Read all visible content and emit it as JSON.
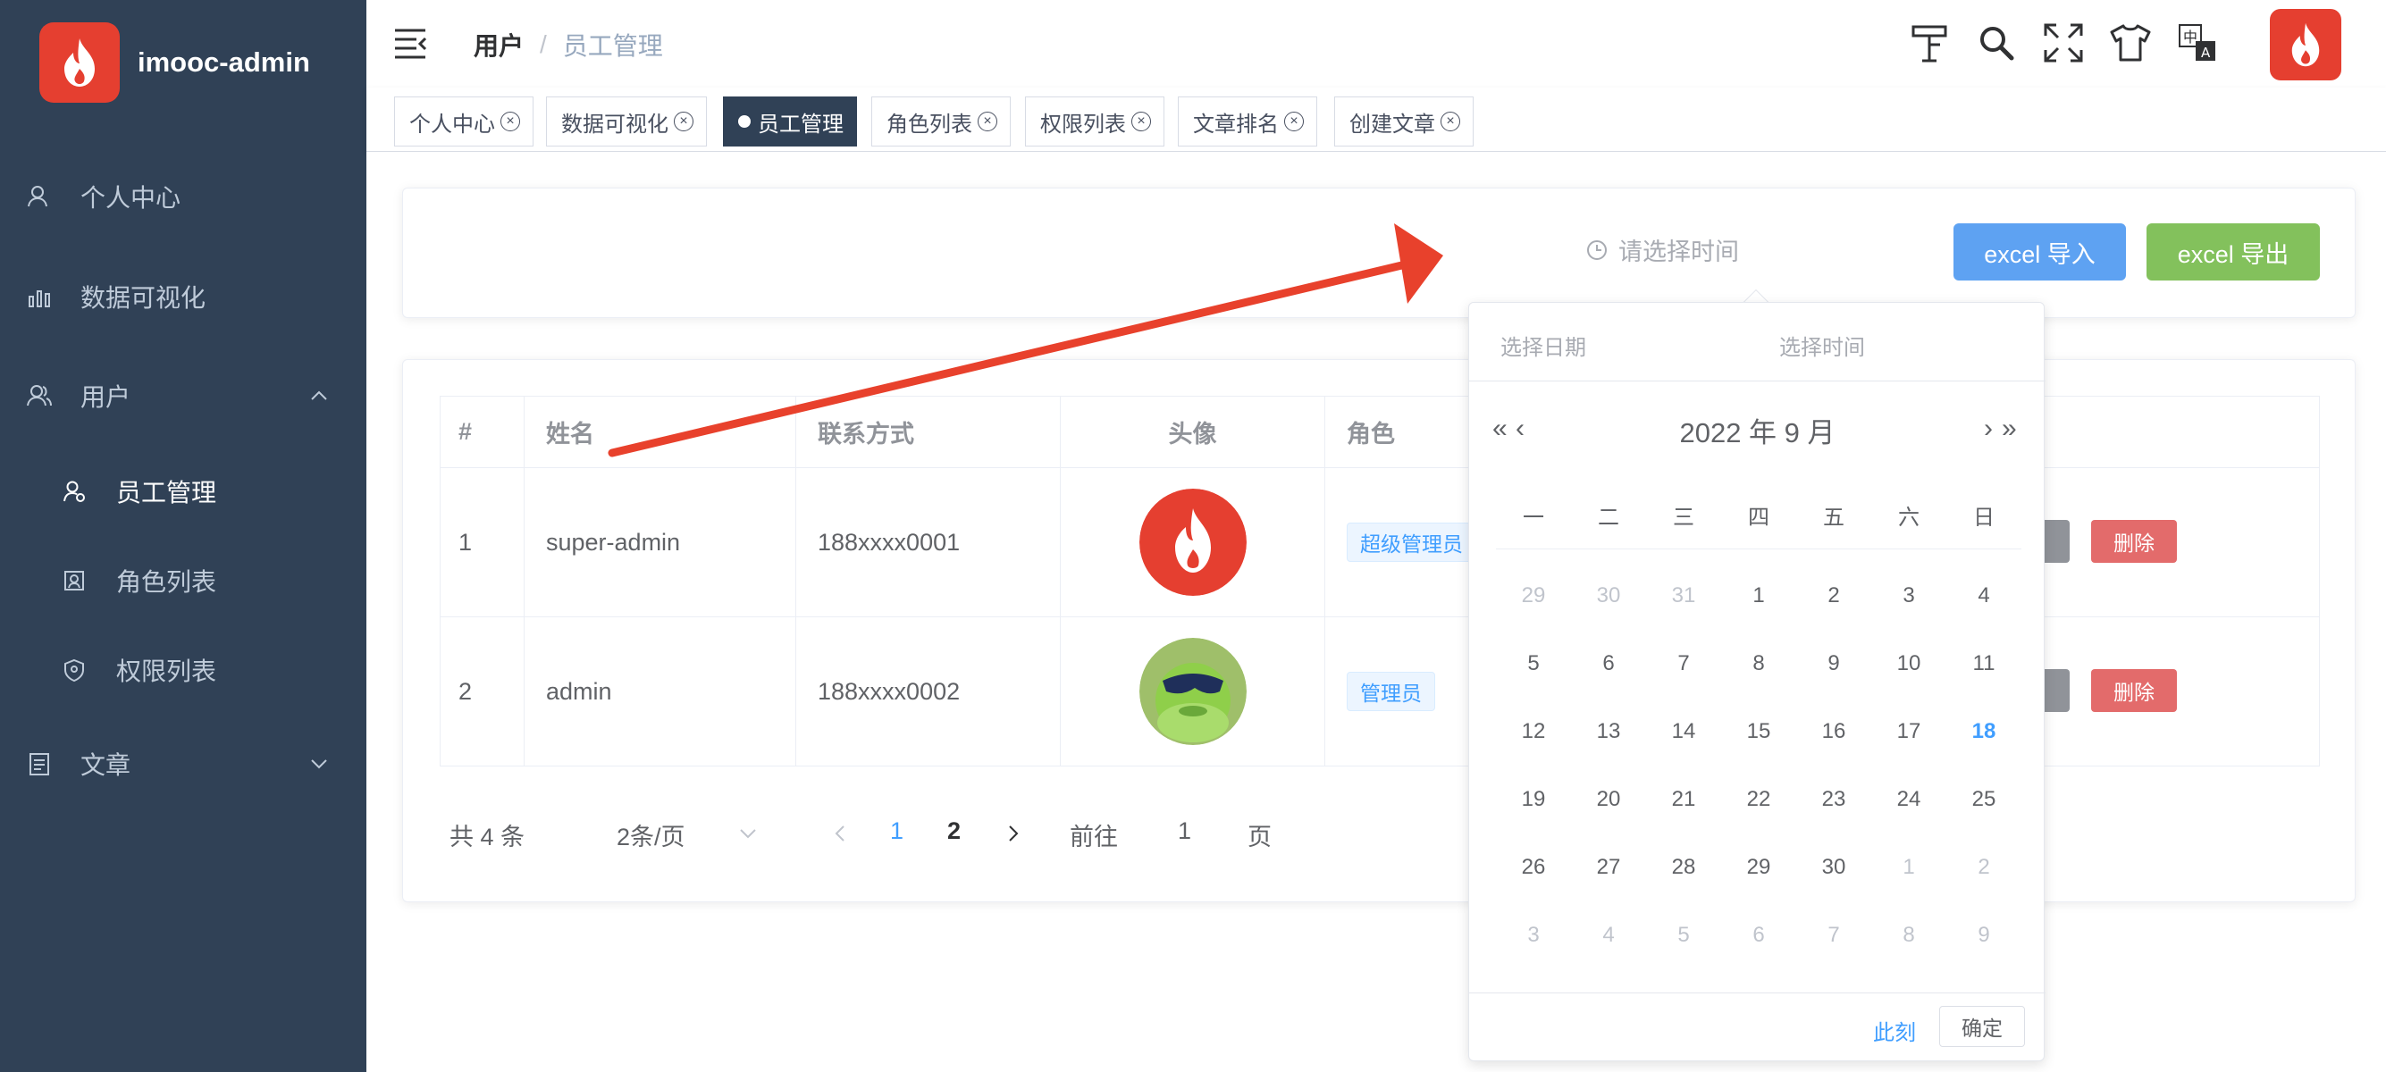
{
  "brand": {
    "name": "imooc-admin"
  },
  "sidebar": {
    "items": [
      {
        "label": "个人中心",
        "icon": "user-icon"
      },
      {
        "label": "数据可视化",
        "icon": "bar-chart-icon"
      },
      {
        "label": "用户",
        "icon": "users-icon",
        "expanded": true
      },
      {
        "label": "文章",
        "icon": "document-icon",
        "expanded": false
      }
    ],
    "subitems": [
      {
        "label": "员工管理",
        "icon": "employee-icon",
        "active": true
      },
      {
        "label": "角色列表",
        "icon": "role-icon"
      },
      {
        "label": "权限列表",
        "icon": "shield-icon"
      }
    ]
  },
  "navbar": {
    "breadcrumb": [
      "用户",
      "员工管理"
    ],
    "separator": "/",
    "icons": [
      "guide-icon",
      "search-icon",
      "fullscreen-icon",
      "theme-icon",
      "language-icon"
    ]
  },
  "tags": [
    {
      "label": "个人中心",
      "active": false
    },
    {
      "label": "数据可视化",
      "active": false
    },
    {
      "label": "员工管理",
      "active": true
    },
    {
      "label": "角色列表",
      "active": false
    },
    {
      "label": "权限列表",
      "active": false
    },
    {
      "label": "文章排名",
      "active": false
    },
    {
      "label": "创建文章",
      "active": false
    }
  ],
  "toolbar": {
    "date_placeholder": "请选择时间",
    "import_label": "excel 导入",
    "export_label": "excel 导出"
  },
  "table": {
    "headers": [
      "#",
      "姓名",
      "联系方式",
      "头像",
      "角色"
    ],
    "rows": [
      {
        "index": "1",
        "name": "super-admin",
        "phone": "188xxxx0001",
        "role": "超级管理员",
        "delete": "删除"
      },
      {
        "index": "2",
        "name": "admin",
        "phone": "188xxxx0002",
        "role": "管理员",
        "delete": "删除"
      }
    ]
  },
  "pagination": {
    "total": "共 4 条",
    "page_size": "2条/页",
    "pages": [
      "1",
      "2"
    ],
    "current": "1",
    "goto_label": "前往",
    "goto_value": "1",
    "goto_suffix": "页"
  },
  "datepicker": {
    "date_placeholder": "选择日期",
    "time_placeholder": "选择时间",
    "title": "2022 年  9 月",
    "weekdays": [
      "一",
      "二",
      "三",
      "四",
      "五",
      "六",
      "日"
    ],
    "days": [
      {
        "d": "29",
        "m": true
      },
      {
        "d": "30",
        "m": true
      },
      {
        "d": "31",
        "m": true
      },
      {
        "d": "1"
      },
      {
        "d": "2"
      },
      {
        "d": "3"
      },
      {
        "d": "4"
      },
      {
        "d": "5"
      },
      {
        "d": "6"
      },
      {
        "d": "7"
      },
      {
        "d": "8"
      },
      {
        "d": "9"
      },
      {
        "d": "10"
      },
      {
        "d": "11"
      },
      {
        "d": "12"
      },
      {
        "d": "13"
      },
      {
        "d": "14"
      },
      {
        "d": "15"
      },
      {
        "d": "16"
      },
      {
        "d": "17"
      },
      {
        "d": "18",
        "today": true
      },
      {
        "d": "19"
      },
      {
        "d": "20"
      },
      {
        "d": "21"
      },
      {
        "d": "22"
      },
      {
        "d": "23"
      },
      {
        "d": "24"
      },
      {
        "d": "25"
      },
      {
        "d": "26"
      },
      {
        "d": "27"
      },
      {
        "d": "28"
      },
      {
        "d": "29"
      },
      {
        "d": "30"
      },
      {
        "d": "1",
        "m": true
      },
      {
        "d": "2",
        "m": true
      },
      {
        "d": "3",
        "m": true
      },
      {
        "d": "4",
        "m": true
      },
      {
        "d": "5",
        "m": true
      },
      {
        "d": "6",
        "m": true
      },
      {
        "d": "7",
        "m": true
      },
      {
        "d": "8",
        "m": true
      },
      {
        "d": "9",
        "m": true
      }
    ],
    "now_label": "此刻",
    "ok_label": "确定"
  },
  "colors": {
    "sidebar": "#304156",
    "accent": "#409eff",
    "brand": "#e53f30",
    "import": "#5ea2f2",
    "export": "#83c15c",
    "danger": "#e36b6b",
    "arrow": "#e8412c"
  }
}
